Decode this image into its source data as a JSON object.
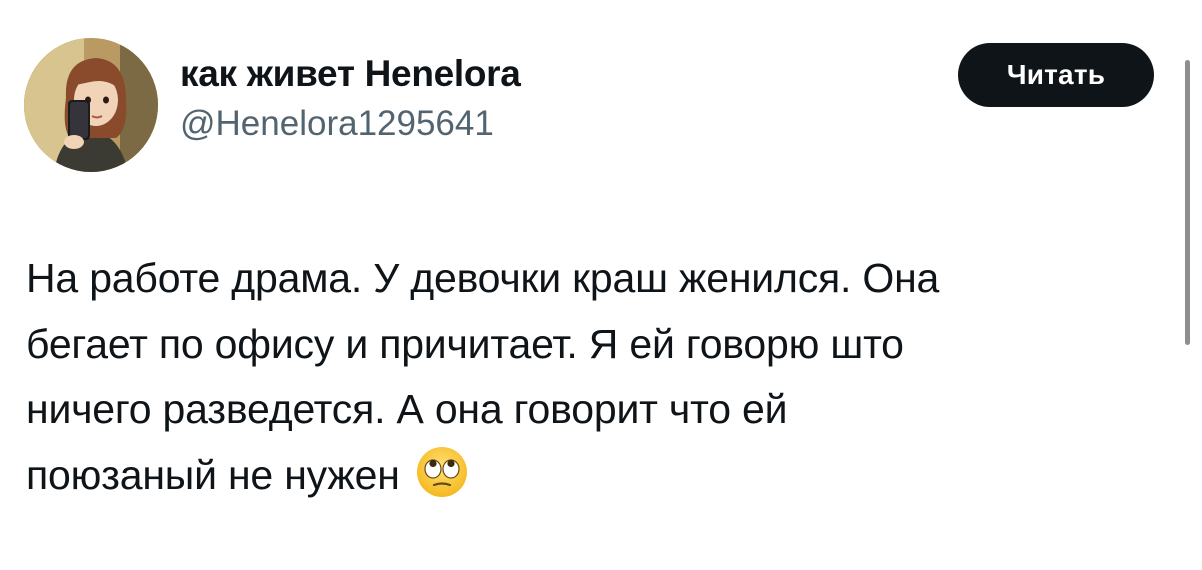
{
  "author": {
    "display_name": "как живет Henelora",
    "handle": "@Henelora1295641",
    "avatar_icon": "avatar-girl-selfie-icon"
  },
  "actions": {
    "follow_label": "Читать"
  },
  "tweet": {
    "lines": [
      "На работе драма. У девочки краш женился. Она",
      "бегает по офису и причитает. Я ей говорю што",
      "ничего разведется. А она говорит что ей",
      "поюзаный не нужен"
    ],
    "emoji": "face-with-rolling-eyes-icon"
  },
  "colors": {
    "text_primary": "#0f1419",
    "text_secondary": "#536471",
    "button_bg": "#0f1419",
    "button_text": "#ffffff",
    "background": "#ffffff"
  }
}
